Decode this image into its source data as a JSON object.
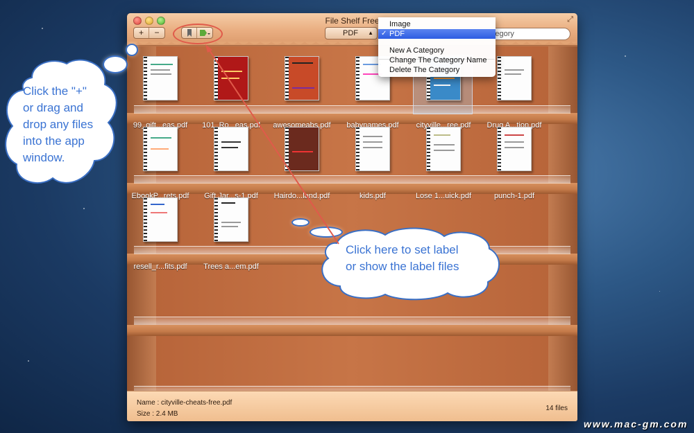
{
  "window": {
    "title": "File Shelf Free",
    "add_label": "+",
    "remove_label": "−",
    "category_value": "PDF",
    "search_placeholder": "rch in the Category"
  },
  "menu": {
    "items": [
      {
        "label": "Image",
        "checked": false,
        "active": false
      },
      {
        "label": "PDF",
        "checked": true,
        "active": true
      },
      {
        "label": "New A Category",
        "checked": false,
        "active": false
      },
      {
        "label": "Change The Category Name",
        "checked": false,
        "active": false
      },
      {
        "label": "Delete The Category",
        "checked": false,
        "active": false
      }
    ],
    "check_mark": "✓"
  },
  "shelves": [
    {
      "files": [
        "99_gift...eas.pdf",
        "101_Ro...eas.pdf",
        "awesomeabs.pdf",
        "babynames.pdf",
        "cityville...ree.pdf",
        "Drug A...tion.pdf"
      ]
    },
    {
      "files": [
        "EbookP...rets.pdf",
        "Gift Jar...s-1.pdf",
        "Hairdo...land.pdf",
        "kids.pdf",
        "Lose 1...uick.pdf",
        "punch-1.pdf"
      ]
    },
    {
      "files": [
        "resell_r...fits.pdf",
        "Trees a...em.pdf"
      ]
    }
  ],
  "footer": {
    "name_label": "Name : cityville-cheats-free.pdf",
    "size_label": "Size   : 2.4 MB",
    "count": "14 files"
  },
  "callouts": {
    "left_line1": "Click the \"+\"",
    "left_line2": "or drag and",
    "left_line3": "drop any files",
    "left_line4": "into the app",
    "left_line5": "window.",
    "right_line1": "Click here to set label",
    "right_line2": "or show the label files"
  },
  "watermark": "www.mac-gm.com",
  "colors": {
    "accent": "#3a73d3",
    "annotation": "#e05a4a",
    "menu_highlight": "#2d5ce2"
  }
}
